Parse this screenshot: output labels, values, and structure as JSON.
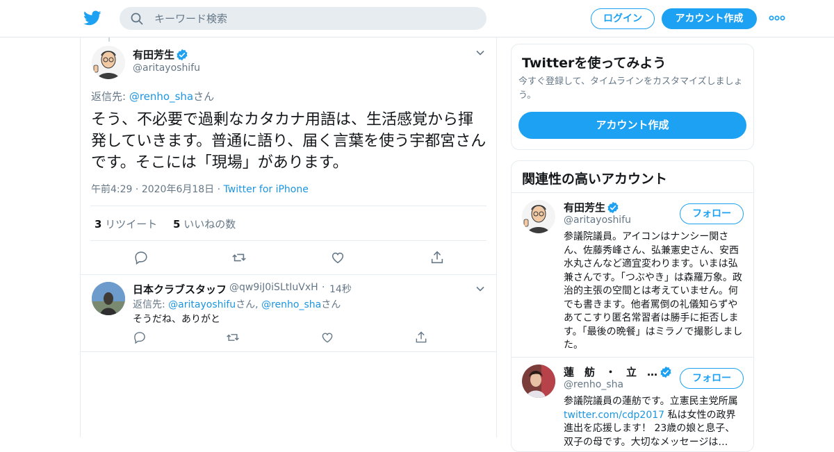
{
  "header": {
    "search_placeholder": "キーワード検索",
    "login_label": "ログイン",
    "signup_label": "アカウント作成"
  },
  "main_tweet": {
    "name": "有田芳生",
    "handle": "@aritayoshifu",
    "reply_prefix": "返信先:",
    "reply_handle": "@renho_sha",
    "reply_suffix": "さん",
    "text": "そう、不必要で過剰なカタカナ用語は、生活感覚から揮発していきます。普通に語り、届く言葉を使う宇都宮さんです。そこには「現場」があります。",
    "time": "午前4:29",
    "date": "2020年6月18日",
    "source": "Twitter for iPhone",
    "retweet_count": "3",
    "retweet_label": "リツイート",
    "like_count": "5",
    "like_label": "いいねの数"
  },
  "reply_tweet": {
    "name": "日本クラブスタッフ",
    "handle": "@qw9iJ0iSLtIuVxH",
    "age": "14秒",
    "reply_prefix": "返信先:",
    "reply_handle1": "@aritayoshifu",
    "reply_mid": "さん,",
    "reply_handle2": "@renho_sha",
    "reply_suffix": "さん",
    "text": "そうだね、ありがと"
  },
  "signup_card": {
    "title": "Twitterを使ってみよう",
    "subtitle": "今すぐ登録して、タイムラインをカスタマイズしましょう。",
    "button": "アカウント作成"
  },
  "related_card": {
    "title": "関連性の高いアカウント",
    "accounts": [
      {
        "name": "有田芳生",
        "handle": "@aritayoshifu",
        "follow": "フォロー",
        "bio": "参議院議員。アイコンはナンシー関さん、佐藤秀峰さん、弘兼憲史さん、安西水丸さんなど適宜変わります。いまは弘兼さんです。「つぶやき」は森羅万象。政治的主張の空間とは考えていません。何でも書きます。他者罵倒の礼儀知らずやあてこすり匿名常習者は勝手に拒否します。「最後の晩餐」はミラノで撮影しました。"
      },
      {
        "name": "蓮　舫　・　立　…",
        "handle": "@renho_sha",
        "follow": "フォロー",
        "bio_a": "参議院議員の蓮舫です。立憲民主党所属",
        "bio_link": "twitter.com/cdp2017",
        "bio_b": "私は女性の政界進出を応援します！ 23歳の娘と息子、双子の母です。大切なメッセージは…"
      }
    ]
  },
  "colors": {
    "accent": "#1da1f2",
    "link": "#1b95e0",
    "muted": "#657786"
  }
}
